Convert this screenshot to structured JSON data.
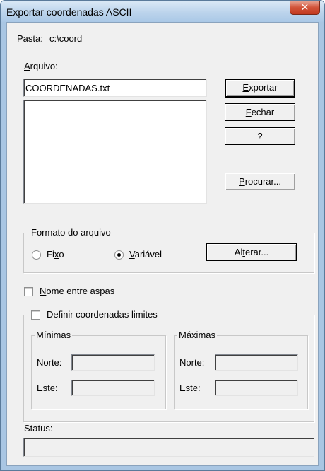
{
  "window": {
    "title": "Exportar coordenadas ASCII",
    "close_glyph": "✕"
  },
  "folder": {
    "label": "Pasta:",
    "value": "c:\\coord"
  },
  "file": {
    "label": "Arquivo:",
    "value": "COORDENADAS.txt"
  },
  "buttons": {
    "exportar": "Exportar",
    "fechar": "Fechar",
    "help": "?",
    "procurar": "Procurar...",
    "alterar": "Alterar..."
  },
  "format_group": {
    "title": "Formato do arquivo",
    "option_fixo": "Fixo",
    "option_variavel": "Variável",
    "selected": "variavel"
  },
  "quoted_names": {
    "label": "Nome entre aspas",
    "checked": false
  },
  "limits_group": {
    "title": "Definir coordenadas limites",
    "checked": false,
    "minimas": {
      "title": "Mínimas",
      "norte_label": "Norte:",
      "este_label": "Este:",
      "norte_value": "",
      "este_value": ""
    },
    "maximas": {
      "title": "Máximas",
      "norte_label": "Norte:",
      "este_label": "Este:",
      "norte_value": "",
      "este_value": ""
    }
  },
  "status": {
    "label": "Status:",
    "value": ""
  }
}
